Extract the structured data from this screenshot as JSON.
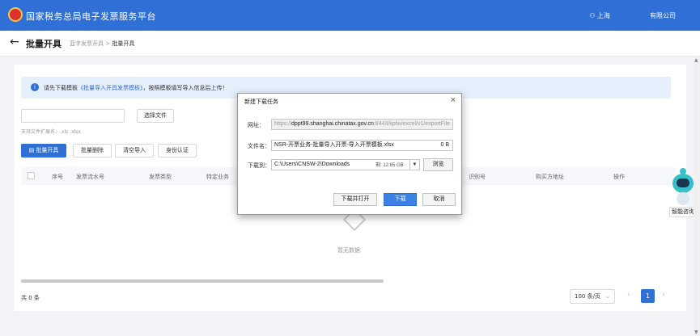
{
  "header": {
    "app_title": "国家税务总局电子发票服务平台",
    "user_label": "上海",
    "company_label": "有限公司"
  },
  "titlebar": {
    "back_icon": "←",
    "page_title": "批量开具",
    "breadcrumb": [
      "蓝字发票开具",
      "批量开具"
    ],
    "breadcrumb_sep": ">"
  },
  "notice": {
    "prefix": "请先下载模板",
    "link": "《批量导入开具发票模板》",
    "suffix": "，按照模板填写导入信息后上传！"
  },
  "upload": {
    "choose_file": "选择文件",
    "hint": "支持文件扩展名：.xls .xlsx"
  },
  "actions": {
    "batch_issue": "批量开具",
    "batch_delete": "批量删除",
    "clear_import": "清空导入",
    "identity_auth": "身份认证"
  },
  "table": {
    "columns": [
      "序号",
      "发票流水号",
      "发票类型",
      "特定业务",
      "识别号",
      "购买方地址",
      "操作"
    ],
    "empty_text": "暂无数据"
  },
  "pagination": {
    "total": "共 0 条",
    "page_size": "100 条/页",
    "current_page": "1",
    "prev_icon": "‹",
    "next_icon": "›"
  },
  "assistant": {
    "label": "智能咨询"
  },
  "download_dialog": {
    "title": "新建下载任务",
    "close_icon": "×",
    "url_label": "网址：",
    "url_prefix": "https://",
    "url_host": "dppt99.shanghai.chinatax.gov.cn",
    "url_suffix": ":8443/kpfw/excel/v1/exportFile",
    "filename_label": "文件名：",
    "filename": "NSR-开票业务-批量导入开票-导入开票模板.xlsx",
    "filesize": "0 B",
    "saveto_label": "下载到：",
    "saveto_path": "C:\\Users\\CNSW-2\\Downloads",
    "free_space": "剩: 12.85 GB",
    "dropdown_icon": "▼",
    "browse": "浏览",
    "download_open": "下载并打开",
    "download": "下载",
    "cancel": "取消"
  }
}
